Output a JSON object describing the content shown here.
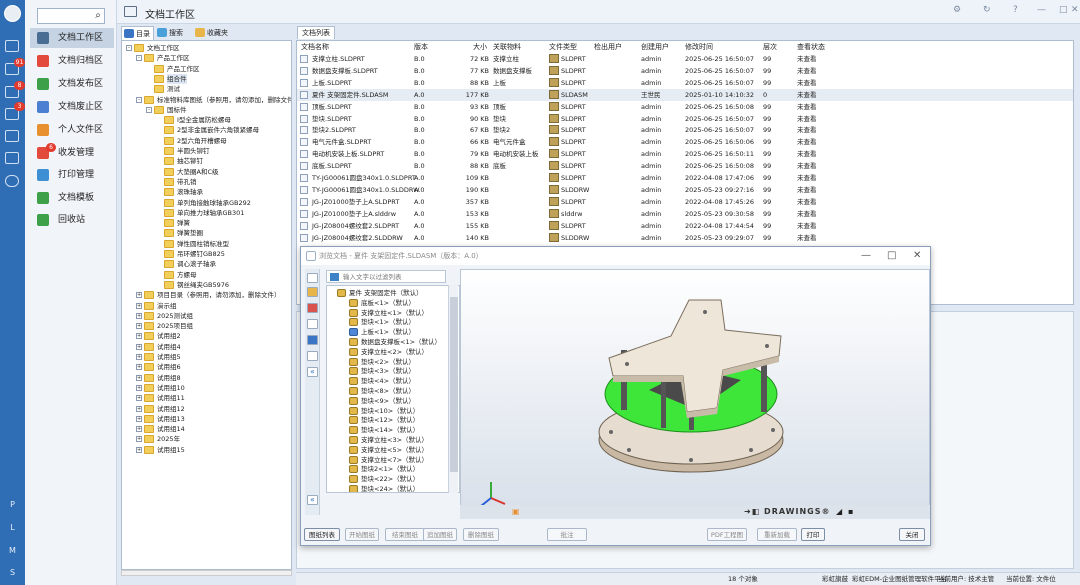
{
  "window": {
    "title": "文档工作区"
  },
  "left_strip": {
    "badges": [
      "91",
      "8",
      "3"
    ],
    "bottom_letters": [
      "P",
      "L",
      "M",
      "S"
    ]
  },
  "search": {
    "placeholder": ""
  },
  "menu": [
    {
      "label": "文档工作区",
      "active": true,
      "color": "#4a6d94"
    },
    {
      "label": "文档归档区",
      "color": "#e24a3b"
    },
    {
      "label": "文档发布区",
      "color": "#3fa04a"
    },
    {
      "label": "文档废止区",
      "color": "#4a7fd1"
    },
    {
      "label": "个人文件区",
      "color": "#e8902f"
    },
    {
      "label": "收发管理",
      "color": "#e24a3b",
      "badge": "6"
    },
    {
      "label": "打印管理",
      "color": "#3f8fd4"
    },
    {
      "label": "文档模板",
      "color": "#3fa04a"
    },
    {
      "label": "回收站",
      "color": "#3fa04a"
    }
  ],
  "left_tabs": [
    "目录",
    "搜索",
    "收藏夹"
  ],
  "tree": [
    {
      "label": "文档工作区",
      "level": 0,
      "exp": "-"
    },
    {
      "label": "产品工作区",
      "level": 1,
      "exp": "-"
    },
    {
      "label": "产品工作区",
      "level": 2,
      "exp": ""
    },
    {
      "label": "组合件",
      "level": 2,
      "exp": "",
      "selected": true
    },
    {
      "label": "测试",
      "level": 2,
      "exp": ""
    },
    {
      "label": "标准物料库图纸（参照用，请勿添加，删除文件）",
      "level": 1,
      "exp": "-"
    },
    {
      "label": "国标件",
      "level": 2,
      "exp": "-"
    },
    {
      "label": "I型全金属防松螺母",
      "level": 3,
      "exp": ""
    },
    {
      "label": "2型非金属嵌件六角锁紧螺母",
      "level": 3,
      "exp": ""
    },
    {
      "label": "2型六角开槽螺母",
      "level": 3,
      "exp": ""
    },
    {
      "label": "半圆头铆钉",
      "level": 3,
      "exp": ""
    },
    {
      "label": "抽芯铆钉",
      "level": 3,
      "exp": ""
    },
    {
      "label": "大垫圈A和C级",
      "level": 3,
      "exp": ""
    },
    {
      "label": "带孔销",
      "level": 3,
      "exp": ""
    },
    {
      "label": "滚珠轴承",
      "level": 3,
      "exp": ""
    },
    {
      "label": "单列角接触球轴承GB292",
      "level": 3,
      "exp": ""
    },
    {
      "label": "单向推力球轴承GB301",
      "level": 3,
      "exp": ""
    },
    {
      "label": "弹簧",
      "level": 3,
      "exp": ""
    },
    {
      "label": "弹簧垫圈",
      "level": 3,
      "exp": ""
    },
    {
      "label": "弹性圆柱销标准型",
      "level": 3,
      "exp": ""
    },
    {
      "label": "吊环螺钉GB825",
      "level": 3,
      "exp": ""
    },
    {
      "label": "调心滚子轴承",
      "level": 3,
      "exp": ""
    },
    {
      "label": "方螺母",
      "level": 3,
      "exp": ""
    },
    {
      "label": "钢丝绳夹GB5976",
      "level": 3,
      "exp": ""
    },
    {
      "label": "项目目录（参照用，请勿添加，删除文件）",
      "level": 1,
      "exp": "+"
    },
    {
      "label": "演示组",
      "level": 1,
      "exp": "+"
    },
    {
      "label": "2025测试组",
      "level": 1,
      "exp": "+"
    },
    {
      "label": "2025项目组",
      "level": 1,
      "exp": "+"
    },
    {
      "label": "试用组2",
      "level": 1,
      "exp": "+"
    },
    {
      "label": "试用组4",
      "level": 1,
      "exp": "+"
    },
    {
      "label": "试用组5",
      "level": 1,
      "exp": "+"
    },
    {
      "label": "试用组6",
      "level": 1,
      "exp": "+"
    },
    {
      "label": "试用组8",
      "level": 1,
      "exp": "+"
    },
    {
      "label": "试用组10",
      "level": 1,
      "exp": "+"
    },
    {
      "label": "试用组11",
      "level": 1,
      "exp": "+"
    },
    {
      "label": "试用组12",
      "level": 1,
      "exp": "+"
    },
    {
      "label": "试用组13",
      "level": 1,
      "exp": "+"
    },
    {
      "label": "试用组14",
      "level": 1,
      "exp": "+"
    },
    {
      "label": "2025年",
      "level": 1,
      "exp": "+"
    },
    {
      "label": "试用组15",
      "level": 1,
      "exp": "+"
    }
  ],
  "list_tab": "文档列表",
  "columns": [
    "文档名称",
    "版本",
    "大小",
    "关联物料",
    "文件类型",
    "检出用户",
    "创建用户",
    "修改时间",
    "层次",
    "查看状态"
  ],
  "rows": [
    [
      "支撑立柱.SLDPRT",
      "B.0",
      "72 KB",
      "支撑立柱",
      "SLDPRT",
      "",
      "admin",
      "2025-06-25 16:50:07",
      "99",
      "未查看"
    ],
    [
      "数据盘支撑板.SLDPRT",
      "B.0",
      "77 KB",
      "数据盘支撑板",
      "SLDPRT",
      "",
      "admin",
      "2025-06-25 16:50:07",
      "99",
      "未查看"
    ],
    [
      "上板.SLDPRT",
      "B.0",
      "88 KB",
      "上板",
      "SLDPRT",
      "",
      "admin",
      "2025-06-25 16:50:07",
      "99",
      "未查看"
    ],
    [
      "夏件 支架固定件.SLDASM",
      "A.0",
      "177 KB",
      "",
      "SLDASM",
      "",
      "王世民",
      "2025-01-10 14:10:32",
      "0",
      "未查看"
    ],
    [
      "顶板.SLDPRT",
      "B.0",
      "93 KB",
      "顶板",
      "SLDPRT",
      "",
      "admin",
      "2025-06-25 16:50:08",
      "99",
      "未查看"
    ],
    [
      "垫块.SLDPRT",
      "B.0",
      "90 KB",
      "垫块",
      "SLDPRT",
      "",
      "admin",
      "2025-06-25 16:50:07",
      "99",
      "未查看"
    ],
    [
      "垫块2.SLDPRT",
      "B.0",
      "67 KB",
      "垫块2",
      "SLDPRT",
      "",
      "admin",
      "2025-06-25 16:50:07",
      "99",
      "未查看"
    ],
    [
      "电气元件盒.SLDPRT",
      "B.0",
      "66 KB",
      "电气元件盒",
      "SLDPRT",
      "",
      "admin",
      "2025-06-25 16:50:06",
      "99",
      "未查看"
    ],
    [
      "电动机安装上板.SLDPRT",
      "B.0",
      "79 KB",
      "电动机安装上板",
      "SLDPRT",
      "",
      "admin",
      "2025-06-25 16:50:11",
      "99",
      "未查看"
    ],
    [
      "底板.SLDPRT",
      "B.0",
      "88 KB",
      "底板",
      "SLDPRT",
      "",
      "admin",
      "2025-06-25 16:50:08",
      "99",
      "未查看"
    ],
    [
      "TY-JG00061圆盘340x1.0.SLDPRT",
      "A.0",
      "109 KB",
      "",
      "SLDPRT",
      "",
      "admin",
      "2022-04-08 17:47:06",
      "99",
      "未查看"
    ],
    [
      "TY-JG00061圆盘340x1.0.SLDDRW",
      "A.0",
      "190 KB",
      "",
      "SLDDRW",
      "",
      "admin",
      "2025-05-23 09:27:16",
      "99",
      "未查看"
    ],
    [
      "JG-JZ01000垫子上A.SLDPRT",
      "A.0",
      "357 KB",
      "",
      "SLDPRT",
      "",
      "admin",
      "2022-04-08 17:45:26",
      "99",
      "未查看"
    ],
    [
      "JG-JZ01000垫子上A.slddrw",
      "A.0",
      "153 KB",
      "",
      "slddrw",
      "",
      "admin",
      "2025-05-23 09:30:58",
      "99",
      "未查看"
    ],
    [
      "JG-JZ08004螺纹套2.SLDPRT",
      "A.0",
      "155 KB",
      "",
      "SLDPRT",
      "",
      "admin",
      "2022-04-08 17:44:54",
      "99",
      "未查看"
    ],
    [
      "JG-JZ08004螺纹套2.SLDDRW",
      "A.0",
      "140 KB",
      "",
      "SLDDRW",
      "",
      "admin",
      "2025-05-23 09:29:07",
      "99",
      "未查看"
    ]
  ],
  "status": {
    "count": "18 个对象",
    "platform": "彩虹旗鼓",
    "software": "彩虹EDM-企业图纸管理软件平台",
    "user": "当前用户: 技术主管",
    "location": "当前位置: 文件位"
  },
  "dialog": {
    "title": "浏览文档 - 夏件 支架固定件.SLDASM（版本：A.0）",
    "filter_placeholder": "输入文字以过滤列表",
    "nodes": [
      {
        "label": "夏件 支架固定件（默认）",
        "level": 0,
        "blue": false
      },
      {
        "label": "底板<1>（默认）",
        "level": 1
      },
      {
        "label": "支撑立柱<1>（默认）",
        "level": 1
      },
      {
        "label": "垫块<1>（默认）",
        "level": 1
      },
      {
        "label": "上板<1>（默认）",
        "level": 1,
        "blue": true
      },
      {
        "label": "数据盘支撑板<1>（默认）",
        "level": 1
      },
      {
        "label": "支撑立柱<2>（默认）",
        "level": 1
      },
      {
        "label": "垫块<2>（默认）",
        "level": 1
      },
      {
        "label": "垫块<3>（默认）",
        "level": 1
      },
      {
        "label": "垫块<4>（默认）",
        "level": 1
      },
      {
        "label": "垫块<8>（默认）",
        "level": 1
      },
      {
        "label": "垫块<9>（默认）",
        "level": 1
      },
      {
        "label": "垫块<10>（默认）",
        "level": 1
      },
      {
        "label": "垫块<12>（默认）",
        "level": 1
      },
      {
        "label": "垫块<14>（默认）",
        "level": 1
      },
      {
        "label": "支撑立柱<3>（默认）",
        "level": 1
      },
      {
        "label": "支撑立柱<5>（默认）",
        "level": 1
      },
      {
        "label": "支撑立柱<7>（默认）",
        "level": 1
      },
      {
        "label": "垫块2<1>（默认）",
        "level": 1
      },
      {
        "label": "垫块<22>（默认）",
        "level": 1
      },
      {
        "label": "垫块<24>（默认）",
        "level": 1
      }
    ],
    "logo": "DRAWINGS",
    "buttons": [
      "图纸列表",
      "开始图纸",
      "结束图纸",
      "追加图纸",
      "删除图纸",
      "批注",
      "PDF工程图",
      "重新加载",
      "打印",
      "关闭"
    ]
  }
}
